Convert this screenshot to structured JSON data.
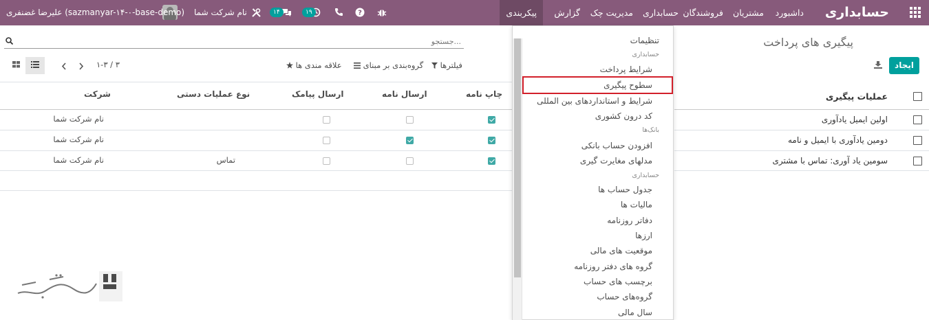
{
  "app": {
    "brand": "حسابداری"
  },
  "topmenu": {
    "items": [
      "داشبورد",
      "مشتریان",
      "فروشندگان",
      "حسابداری",
      "مدیریت چک",
      "گزارش",
      "پیکربندی"
    ],
    "active": "پیکربندی"
  },
  "systray": {
    "company": "نام شرکت شما",
    "messages_badge": "۱۴",
    "activity_badge": "۱۹",
    "user": "علیرضا غضنفری (sazmanyar-۱۴-۰-base-demo)"
  },
  "page": {
    "title": "پیگیری های پرداخت"
  },
  "toolbar": {
    "create_label": "ایجاد"
  },
  "search": {
    "placeholder": "جستجو..."
  },
  "filters": {
    "filter_label": "فیلترها",
    "groupby_label": "گروه‌بندی بر مبنای",
    "favorites_label": "علاقه مندی ها"
  },
  "pager": {
    "value": "۱-۳ / ۳"
  },
  "table": {
    "columns": {
      "print": "چاپ نامه",
      "send_letter": "ارسال نامه",
      "send_sms": "ارسال پیامک",
      "manual_action": "نوع عملیات دستی",
      "company": "شرکت"
    },
    "rows": [
      {
        "print": true,
        "send_letter": false,
        "send_sms": false,
        "manual_action": "",
        "company": "نام شرکت شما"
      },
      {
        "print": true,
        "send_letter": true,
        "send_sms": false,
        "manual_action": "",
        "company": "نام شرکت شما"
      },
      {
        "print": true,
        "send_letter": false,
        "send_sms": false,
        "manual_action": "تماس",
        "company": "نام شرکت شما"
      }
    ]
  },
  "followup_list": {
    "header": "عملیات پیگیری",
    "items": [
      "اولین ایمیل یادآوری",
      "دومین یادآوری با ایمیل و نامه",
      "سومین یاد آوری: تماس با مشتری"
    ]
  },
  "dropdown": {
    "settings": "تنظیمات",
    "section_accounting": "حسابداری",
    "payment_terms": "شرایط پرداخت",
    "followup_levels": "سطوح پیگیری",
    "incoterms": "شرایط و استانداردهای بین المللی",
    "domestic_code": "کد درون کشوری",
    "section_banks": "بانک‌ها",
    "add_bank_account": "افزودن حساب بانکی",
    "reconciliation_models": "مدلهای مغایرت گیری",
    "section_accounting_2": "حسابداری",
    "chart_of_accounts": "جدول حساب ها",
    "taxes": "مالیات ها",
    "journals": "دفاتر روزنامه",
    "currencies": "ارزها",
    "fiscal_positions": "موقعیت های مالی",
    "journal_groups": "گروه های دفتر روزنامه",
    "account_tags": "برچسب های حساب",
    "account_groups": "گروه‌های حساب",
    "fiscal_year": "سال مالی"
  },
  "colors": {
    "navbar": "#875a7b",
    "accent": "#00a09d",
    "highlight": "#d21f2a"
  }
}
